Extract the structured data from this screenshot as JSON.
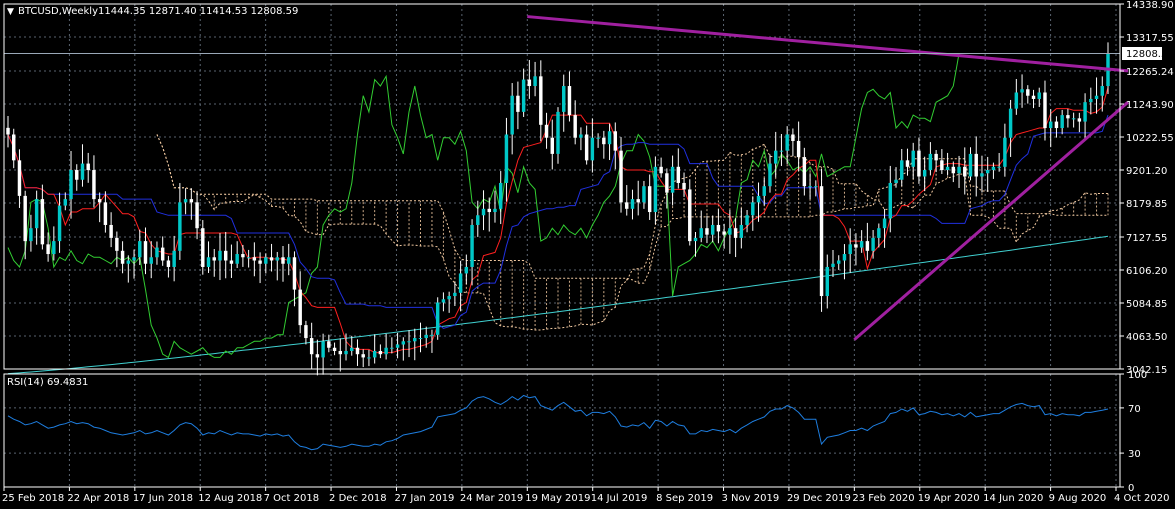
{
  "header": {
    "symbol": "BTCUSD,Weekly",
    "ohlc": "11444.35 12871.40 11414.53 12808.59",
    "rsi_label": "RSI(14) 69.4831"
  },
  "colors": {
    "background": "#000000",
    "frame": "#ffffff",
    "grid": "#5a6470",
    "bull": "#00c8c8",
    "bear": "#ffffff",
    "tenkan": "#ff2020",
    "kijun": "#2030e0",
    "chikou": "#32cd32",
    "ma": "#40d0d0",
    "cloud": "#f0c8a0",
    "trendline": "#a020a0",
    "rsi": "#1e7ee0"
  },
  "chart_data": [
    {
      "type": "candlestick",
      "title": "BTCUSD,Weekly",
      "ylim": [
        3042.15,
        14338.9
      ],
      "y_ticks": [
        "14338.90",
        "13317.55",
        "12265.24",
        "11243.90",
        "10222.55",
        "9201.20",
        "8179.85",
        "7127.55",
        "6106.20",
        "5084.85",
        "4063.50",
        "3042.15"
      ],
      "x_ticks": [
        "25 Feb 2018",
        "22 Apr 2018",
        "17 Jun 2018",
        "12 Aug 2018",
        "7 Oct 2018",
        "2 Dec 2018",
        "27 Jan 2019",
        "24 Mar 2019",
        "19 May 2019",
        "14 Jul 2019",
        "8 Sep 2019",
        "3 Nov 2019",
        "29 Dec 2019",
        "23 Feb 2020",
        "19 Apr 2020",
        "14 Jun 2020",
        "9 Aug 2020",
        "4 Oct 2020"
      ],
      "current_price": "12808.59",
      "close_series": [
        10300,
        9500,
        8400,
        7000,
        7400,
        8300,
        6900,
        6600,
        7000,
        8100,
        8300,
        9200,
        8900,
        9400,
        9200,
        8300,
        8200,
        7500,
        7100,
        6700,
        6300,
        6400,
        6500,
        7000,
        6300,
        6500,
        6800,
        6400,
        6200,
        6700,
        8200,
        8300,
        8200,
        7400,
        6200,
        6500,
        6400,
        6700,
        6400,
        6300,
        6600,
        6500,
        6500,
        6400,
        6300,
        6500,
        6400,
        6500,
        6300,
        6500,
        5500,
        4400,
        4000,
        3500,
        3400,
        3900,
        3700,
        3600,
        3500,
        3600,
        3700,
        3500,
        3400,
        3400,
        3600,
        3500,
        3700,
        3700,
        3800,
        3900,
        3900,
        4000,
        4000,
        4100,
        4100,
        5100,
        5200,
        5300,
        5400,
        6000,
        6200,
        7500,
        7800,
        8000,
        7900,
        8000,
        8800,
        10300,
        11500,
        11000,
        12000,
        11800,
        12100,
        10600,
        10200,
        9700,
        11000,
        11800,
        10900,
        10200,
        10300,
        9500,
        10200,
        10200,
        10000,
        10400,
        9800,
        8200,
        8000,
        8300,
        8200,
        8700,
        7900,
        9300,
        9100,
        8500,
        9300,
        8800,
        8600,
        7000,
        7100,
        7400,
        7200,
        7500,
        7300,
        7200,
        7400,
        7100,
        7500,
        7800,
        8200,
        8400,
        8700,
        9400,
        9800,
        9800,
        10300,
        10100,
        9600,
        8700,
        8700,
        8700,
        5300,
        6200,
        6300,
        6400,
        6600,
        6900,
        6800,
        7000,
        6700,
        7100,
        7400,
        7700,
        8800,
        8900,
        9500,
        9300,
        9800,
        9000,
        9200,
        9700,
        9500,
        9200,
        9300,
        9100,
        9300,
        9000,
        9700,
        9000,
        9100,
        9200,
        9300,
        9300,
        10200,
        11100,
        11600,
        11700,
        11500,
        11400,
        11600,
        10500,
        10700,
        10500,
        10900,
        10800,
        10800,
        10700,
        11300,
        11400,
        11500,
        11800,
        12800
      ],
      "ma_start": 2900,
      "ma_end": 7150,
      "trendlines": [
        {
          "from": [
            "19 May 2019",
            13950
          ],
          "to": [
            "4 Oct 2020",
            12270
          ]
        },
        {
          "from": [
            "23 Feb 2020",
            3950
          ],
          "to": [
            "4 Oct 2020",
            11300
          ]
        }
      ]
    },
    {
      "type": "line",
      "title": "RSI(14) 69.4831",
      "ylim": [
        0,
        100
      ],
      "y_ticks": [
        "100",
        "70",
        "30",
        "0"
      ],
      "values": [
        63,
        60,
        58,
        55,
        56,
        58,
        55,
        52,
        53,
        55,
        56,
        58,
        56,
        57,
        56,
        53,
        52,
        50,
        48,
        47,
        46,
        47,
        48,
        50,
        47,
        48,
        50,
        48,
        46,
        50,
        55,
        57,
        56,
        52,
        46,
        48,
        47,
        50,
        48,
        46,
        48,
        47,
        47,
        46,
        45,
        47,
        46,
        47,
        45,
        46,
        40,
        36,
        35,
        33,
        34,
        38,
        37,
        36,
        35,
        36,
        38,
        37,
        36,
        36,
        38,
        37,
        40,
        41,
        43,
        46,
        47,
        48,
        49,
        51,
        53,
        62,
        63,
        64,
        65,
        68,
        70,
        76,
        79,
        80,
        78,
        75,
        73,
        76,
        80,
        77,
        81,
        79,
        80,
        72,
        70,
        68,
        72,
        75,
        71,
        67,
        68,
        63,
        66,
        66,
        65,
        67,
        62,
        54,
        53,
        55,
        54,
        57,
        52,
        59,
        58,
        54,
        58,
        55,
        54,
        47,
        47,
        50,
        49,
        51,
        50,
        49,
        51,
        48,
        52,
        55,
        58,
        60,
        62,
        67,
        69,
        69,
        72,
        70,
        66,
        60,
        60,
        60,
        38,
        44,
        45,
        46,
        48,
        50,
        50,
        52,
        50,
        54,
        56,
        58,
        65,
        66,
        69,
        67,
        70,
        64,
        65,
        67,
        66,
        64,
        65,
        63,
        65,
        62,
        66,
        62,
        63,
        64,
        65,
        65,
        68,
        71,
        73,
        74,
        72,
        71,
        72,
        64,
        65,
        63,
        65,
        64,
        64,
        63,
        66,
        66,
        67,
        68,
        69
      ]
    }
  ]
}
